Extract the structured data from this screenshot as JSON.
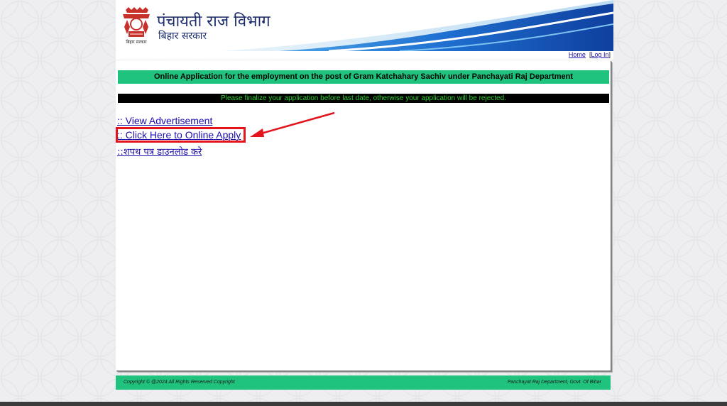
{
  "header": {
    "title": "पंचायती राज विभाग",
    "subtitle": "बिहार सरकार",
    "emblem_caption": "बिहार सरकार",
    "emblem_icon": "bihar-emblem-icon"
  },
  "topnav": {
    "home": "Home",
    "login": "Log In",
    "bracket_open": "[",
    "bracket_close": "]"
  },
  "main": {
    "heading": "Online Application for the employment on the post of Gram Katchahary Sachiv under Panchayati Raj Department",
    "notice": "Please finalize your application before last date, otherwise your application will be rejected.",
    "links": [
      ":: View Advertisement",
      ":: Click Here to Online Apply",
      "::शपथ पत्र डाउनलोड करे"
    ],
    "highlight_color": "#e3141c"
  },
  "footer": {
    "copyright": "Copyright © @2024 All Rights Reserved Copyright",
    "dept": "Panchayat Raj Department, Govt. Of Bihar"
  },
  "colors": {
    "accent_green": "#20c37e",
    "notice_bg": "#000000",
    "notice_text": "#2bd02b",
    "header_blue": "#1565c0",
    "link": "#1a0dab"
  }
}
